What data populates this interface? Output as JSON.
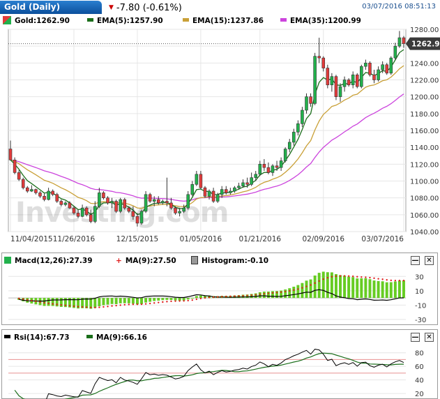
{
  "header": {
    "title": "Gold (Daily)",
    "change_text": "-7.80 (-0.61%)",
    "timestamp": "03/07/2016 08:51:13"
  },
  "main_legend": {
    "price": "Gold:1262.90",
    "ema5": "EMA(5):1257.90",
    "ema15": "EMA(15):1237.86",
    "ema35": "EMA(35):1200.99"
  },
  "macd_legend": {
    "macd": "Macd(12,26):27.39",
    "ma": "MA(9):27.50",
    "histogram": "Histogram:-0.10"
  },
  "rsi_legend": {
    "rsi": "Rsi(14):67.73",
    "ma": "MA(9):66.16"
  },
  "watermark": "Investing.com",
  "colors": {
    "up": "#22b14c",
    "down": "#e23b3b",
    "ema5": "#1a6e1a",
    "ema15": "#c9a037",
    "ema35": "#cc44dd",
    "macd_bar": "#66cc22",
    "macd_line": "#000000",
    "macd_signal": "#e02020",
    "rsi_line": "#000000",
    "rsi_ma": "#1a6e1a",
    "axis_text": "#333333",
    "grid": "#e6e6e6"
  },
  "chart_data": [
    {
      "type": "candlestick",
      "title": "Gold (Daily)",
      "ylim": [
        1040,
        1280
      ],
      "y_ticks": [
        1040,
        1060,
        1080,
        1100,
        1120,
        1140,
        1160,
        1180,
        1200,
        1220,
        1240,
        1260,
        1280
      ],
      "x_tick_labels": [
        "11/04/2015",
        "11/26/2016",
        "12/15/2015",
        "01/05/2016",
        "01/21/2016",
        "02/09/2016",
        "03/07/2016"
      ],
      "x_tick_index": [
        0,
        15,
        30,
        45,
        59,
        74,
        93
      ],
      "current_price": 1262.9,
      "current_price_label": "1262.90",
      "candles": [
        [
          1138,
          1148,
          1128,
          1125
        ],
        [
          1125,
          1128,
          1108,
          1110
        ],
        [
          1110,
          1113,
          1100,
          1102
        ],
        [
          1102,
          1104,
          1090,
          1092
        ],
        [
          1092,
          1094,
          1086,
          1088
        ],
        [
          1088,
          1095,
          1087,
          1090
        ],
        [
          1090,
          1091,
          1084,
          1086
        ],
        [
          1086,
          1088,
          1080,
          1082
        ],
        [
          1082,
          1085,
          1076,
          1078
        ],
        [
          1078,
          1092,
          1077,
          1088
        ],
        [
          1088,
          1090,
          1082,
          1084
        ],
        [
          1084,
          1086,
          1074,
          1076
        ],
        [
          1076,
          1078,
          1070,
          1072
        ],
        [
          1072,
          1076,
          1070,
          1074
        ],
        [
          1074,
          1076,
          1067,
          1068
        ],
        [
          1068,
          1070,
          1060,
          1062
        ],
        [
          1062,
          1066,
          1056,
          1058
        ],
        [
          1058,
          1072,
          1057,
          1068
        ],
        [
          1068,
          1070,
          1058,
          1060
        ],
        [
          1060,
          1066,
          1050,
          1052
        ],
        [
          1052,
          1076,
          1050,
          1070
        ],
        [
          1070,
          1092,
          1068,
          1086
        ],
        [
          1086,
          1088,
          1078,
          1080
        ],
        [
          1080,
          1082,
          1072,
          1074
        ],
        [
          1074,
          1080,
          1068,
          1076
        ],
        [
          1076,
          1078,
          1062,
          1064
        ],
        [
          1064,
          1080,
          1062,
          1078
        ],
        [
          1078,
          1080,
          1066,
          1068
        ],
        [
          1068,
          1070,
          1062,
          1064
        ],
        [
          1064,
          1070,
          1054,
          1058
        ],
        [
          1058,
          1062,
          1046,
          1050
        ],
        [
          1050,
          1066,
          1048,
          1064
        ],
        [
          1064,
          1088,
          1062,
          1084
        ],
        [
          1084,
          1086,
          1074,
          1076
        ],
        [
          1076,
          1082,
          1070,
          1078
        ],
        [
          1078,
          1082,
          1072,
          1074
        ],
        [
          1074,
          1078,
          1072,
          1076
        ],
        [
          1076,
          1104,
          1070,
          1074
        ],
        [
          1074,
          1080,
          1066,
          1068
        ],
        [
          1068,
          1070,
          1060,
          1062
        ],
        [
          1062,
          1068,
          1058,
          1064
        ],
        [
          1064,
          1072,
          1062,
          1068
        ],
        [
          1068,
          1088,
          1066,
          1084
        ],
        [
          1084,
          1100,
          1082,
          1096
        ],
        [
          1096,
          1112,
          1094,
          1108
        ],
        [
          1108,
          1112,
          1090,
          1092
        ],
        [
          1092,
          1094,
          1080,
          1082
        ],
        [
          1082,
          1090,
          1078,
          1088
        ],
        [
          1088,
          1092,
          1074,
          1076
        ],
        [
          1076,
          1086,
          1074,
          1084
        ],
        [
          1084,
          1094,
          1080,
          1090
        ],
        [
          1090,
          1094,
          1084,
          1086
        ],
        [
          1086,
          1092,
          1084,
          1088
        ],
        [
          1088,
          1094,
          1086,
          1092
        ],
        [
          1092,
          1098,
          1090,
          1094
        ],
        [
          1094,
          1102,
          1092,
          1098
        ],
        [
          1098,
          1104,
          1092,
          1096
        ],
        [
          1096,
          1110,
          1094,
          1104
        ],
        [
          1104,
          1112,
          1100,
          1108
        ],
        [
          1108,
          1124,
          1106,
          1120
        ],
        [
          1120,
          1126,
          1112,
          1116
        ],
        [
          1116,
          1122,
          1108,
          1110
        ],
        [
          1110,
          1120,
          1106,
          1118
        ],
        [
          1118,
          1124,
          1112,
          1116
        ],
        [
          1116,
          1128,
          1112,
          1124
        ],
        [
          1124,
          1140,
          1122,
          1138
        ],
        [
          1138,
          1150,
          1134,
          1146
        ],
        [
          1146,
          1162,
          1142,
          1158
        ],
        [
          1158,
          1172,
          1154,
          1168
        ],
        [
          1168,
          1188,
          1164,
          1184
        ],
        [
          1184,
          1204,
          1180,
          1200
        ],
        [
          1200,
          1204,
          1188,
          1192
        ],
        [
          1192,
          1252,
          1190,
          1248
        ],
        [
          1248,
          1270,
          1240,
          1246
        ],
        [
          1246,
          1248,
          1230,
          1234
        ],
        [
          1234,
          1238,
          1210,
          1214
        ],
        [
          1214,
          1228,
          1206,
          1224
        ],
        [
          1224,
          1226,
          1196,
          1200
        ],
        [
          1200,
          1216,
          1194,
          1212
        ],
        [
          1212,
          1224,
          1206,
          1220
        ],
        [
          1220,
          1222,
          1212,
          1214
        ],
        [
          1214,
          1230,
          1210,
          1226
        ],
        [
          1226,
          1228,
          1210,
          1212
        ],
        [
          1212,
          1238,
          1210,
          1236
        ],
        [
          1236,
          1244,
          1232,
          1240
        ],
        [
          1240,
          1242,
          1224,
          1226
        ],
        [
          1226,
          1232,
          1216,
          1220
        ],
        [
          1220,
          1236,
          1218,
          1232
        ],
        [
          1232,
          1242,
          1228,
          1238
        ],
        [
          1238,
          1240,
          1226,
          1228
        ],
        [
          1228,
          1248,
          1226,
          1246
        ],
        [
          1246,
          1264,
          1244,
          1260
        ],
        [
          1260,
          1278,
          1258,
          1270
        ],
        [
          1270,
          1272,
          1258,
          1263
        ]
      ]
    },
    {
      "type": "bar",
      "title": "Macd(12,26)",
      "ylim": [
        -32,
        40
      ],
      "y_ticks": [
        30,
        10,
        -10,
        -30
      ]
    },
    {
      "type": "line",
      "title": "Rsi(14)",
      "ylim": [
        14,
        92
      ],
      "y_ticks": [
        80,
        60,
        40,
        20
      ],
      "reference_levels": [
        70,
        50
      ]
    }
  ]
}
